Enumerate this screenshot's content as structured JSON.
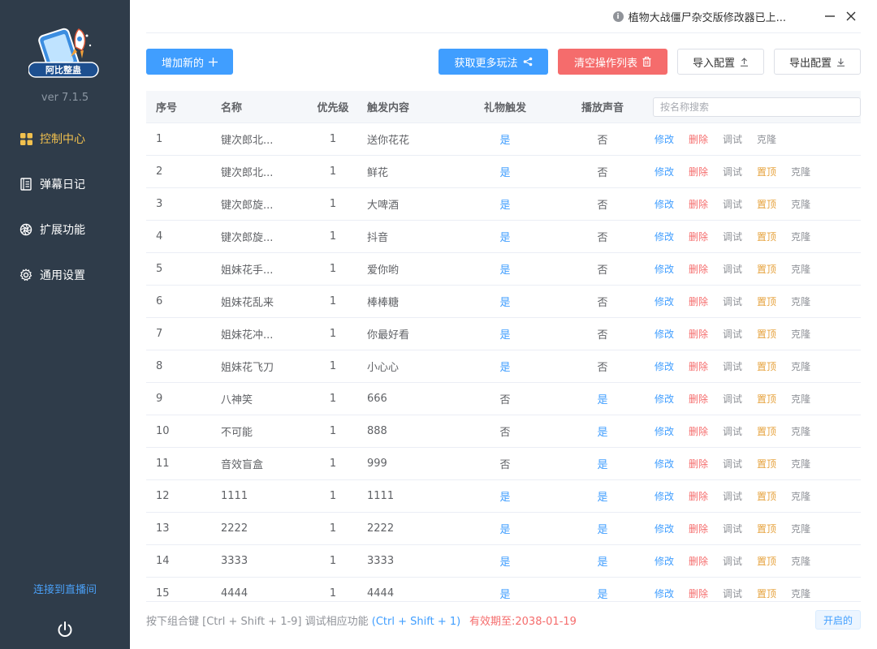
{
  "app": {
    "logo_text": "阿比整蛊",
    "version": "ver 7.1.5",
    "notice": "植物大战僵尸杂交版修改器已上...",
    "colors": {
      "sidebar": "#2f3c4a",
      "primary": "#409eff",
      "danger": "#f56c6c",
      "warning": "#e6a23c",
      "active_nav": "#f2c14e"
    }
  },
  "sidebar": {
    "items": [
      {
        "label": "控制中心",
        "icon": "grid-icon",
        "active": true
      },
      {
        "label": "弹幕日记",
        "icon": "notebook-icon",
        "active": false
      },
      {
        "label": "扩展功能",
        "icon": "aperture-icon",
        "active": false
      },
      {
        "label": "通用设置",
        "icon": "gear-icon",
        "active": false
      }
    ],
    "connect_label": "连接到直播间",
    "power_icon": "power-icon"
  },
  "toolbar": {
    "add_label": "增加新的",
    "more_label": "获取更多玩法",
    "clear_label": "清空操作列表",
    "import_label": "导入配置",
    "export_label": "导出配置"
  },
  "table": {
    "columns": [
      "序号",
      "名称",
      "优先级",
      "触发内容",
      "礼物触发",
      "播放声音"
    ],
    "search_placeholder": "按名称搜索",
    "ops": {
      "edit": "修改",
      "delete": "删除",
      "debug": "调试",
      "top": "置顶",
      "clone": "克隆"
    },
    "rows": [
      {
        "idx": "1",
        "name": "键次郎北...",
        "priority": "1",
        "trigger": "送你花花",
        "gift": "是",
        "sound": "否",
        "show_top": false
      },
      {
        "idx": "2",
        "name": "键次郎北...",
        "priority": "1",
        "trigger": "鲜花",
        "gift": "是",
        "sound": "否",
        "show_top": true
      },
      {
        "idx": "3",
        "name": "键次郎旋...",
        "priority": "1",
        "trigger": "大啤酒",
        "gift": "是",
        "sound": "否",
        "show_top": true
      },
      {
        "idx": "4",
        "name": "键次郎旋...",
        "priority": "1",
        "trigger": "抖音",
        "gift": "是",
        "sound": "否",
        "show_top": true
      },
      {
        "idx": "5",
        "name": "姐妹花手...",
        "priority": "1",
        "trigger": "爱你哟",
        "gift": "是",
        "sound": "否",
        "show_top": true
      },
      {
        "idx": "6",
        "name": "姐妹花乱来",
        "priority": "1",
        "trigger": "棒棒糖",
        "gift": "是",
        "sound": "否",
        "show_top": true
      },
      {
        "idx": "7",
        "name": "姐妹花冲...",
        "priority": "1",
        "trigger": "你最好看",
        "gift": "是",
        "sound": "否",
        "show_top": true
      },
      {
        "idx": "8",
        "name": "姐妹花飞刀",
        "priority": "1",
        "trigger": "小心心",
        "gift": "是",
        "sound": "否",
        "show_top": true
      },
      {
        "idx": "9",
        "name": "八神笑",
        "priority": "1",
        "trigger": "666",
        "gift": "否",
        "sound": "是",
        "show_top": true
      },
      {
        "idx": "10",
        "name": "不可能",
        "priority": "1",
        "trigger": "888",
        "gift": "否",
        "sound": "是",
        "show_top": true
      },
      {
        "idx": "11",
        "name": "音效盲盒",
        "priority": "1",
        "trigger": "999",
        "gift": "否",
        "sound": "是",
        "show_top": true
      },
      {
        "idx": "12",
        "name": "1111",
        "priority": "1",
        "trigger": "1111",
        "gift": "是",
        "sound": "是",
        "show_top": true
      },
      {
        "idx": "13",
        "name": "2222",
        "priority": "1",
        "trigger": "2222",
        "gift": "是",
        "sound": "是",
        "show_top": true
      },
      {
        "idx": "14",
        "name": "3333",
        "priority": "1",
        "trigger": "3333",
        "gift": "是",
        "sound": "是",
        "show_top": true
      },
      {
        "idx": "15",
        "name": "4444",
        "priority": "1",
        "trigger": "4444",
        "gift": "是",
        "sound": "是",
        "show_top": true
      }
    ]
  },
  "footer": {
    "hint": "按下组合键 [Ctrl + Shift + 1-9] 调试相应功能",
    "hint_example": "(Ctrl + Shift + 1)",
    "expiry": "有效期至:2038-01-19",
    "status_tag": "开启的"
  }
}
